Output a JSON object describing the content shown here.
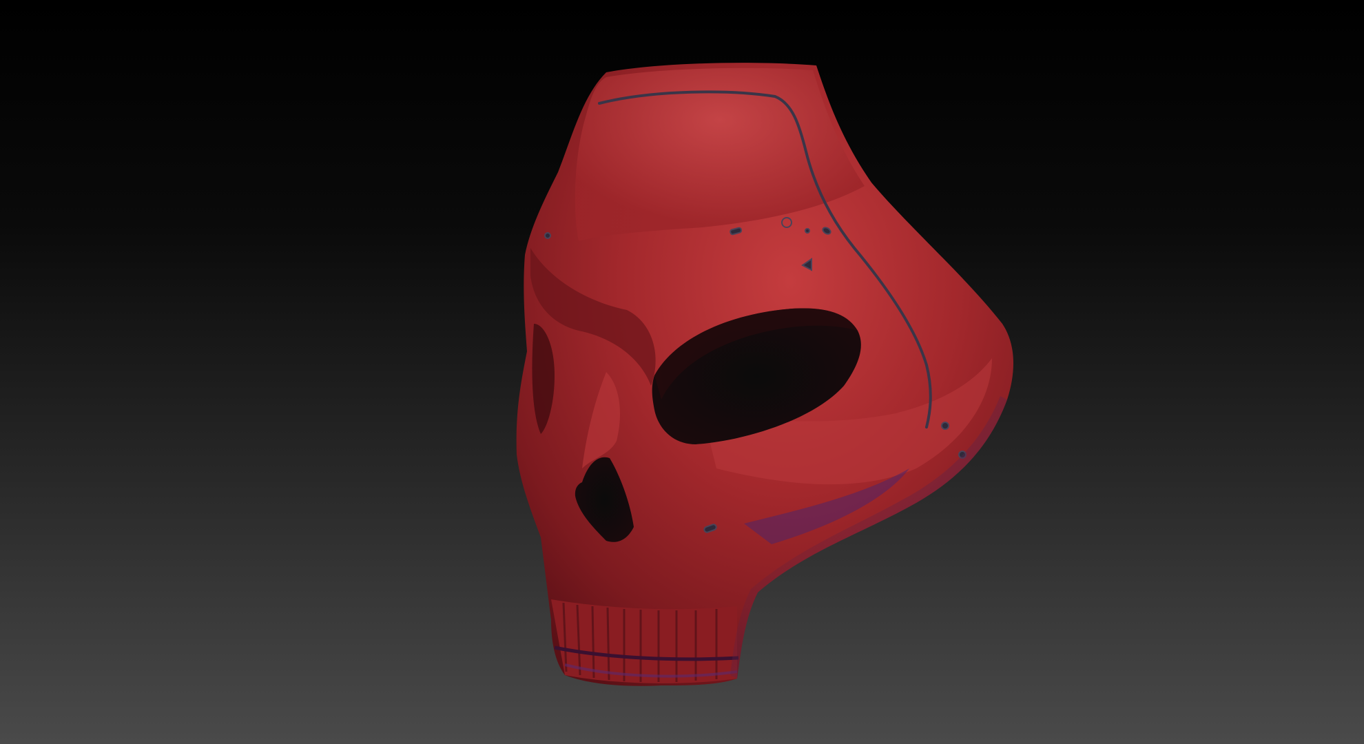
{
  "scene": {
    "subject": "red-skull-mask",
    "colors": {
      "background_top": "#000000",
      "background_bottom": "#4a4a4a",
      "mask_base": "#a0272b",
      "mask_highlight": "#c84a4a",
      "mask_shadow": "#5e1218",
      "rim_light": "#5a2a70",
      "groove_line": "#3a3548"
    }
  }
}
